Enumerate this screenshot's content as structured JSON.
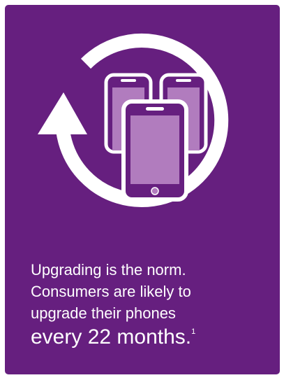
{
  "colors": {
    "background": "#661f7f",
    "phone_screen": "#b17cbe",
    "outline": "#ffffff",
    "text": "#ffffff"
  },
  "illustration": {
    "icons": [
      "circular-arrow-icon",
      "phone-icon",
      "phone-icon",
      "phone-icon"
    ]
  },
  "caption": {
    "line1": "Upgrading is the norm.",
    "line2": "Consumers are likely to",
    "line3": "upgrade their phones",
    "highlight": "every 22 months.",
    "footnote_marker": "1"
  }
}
